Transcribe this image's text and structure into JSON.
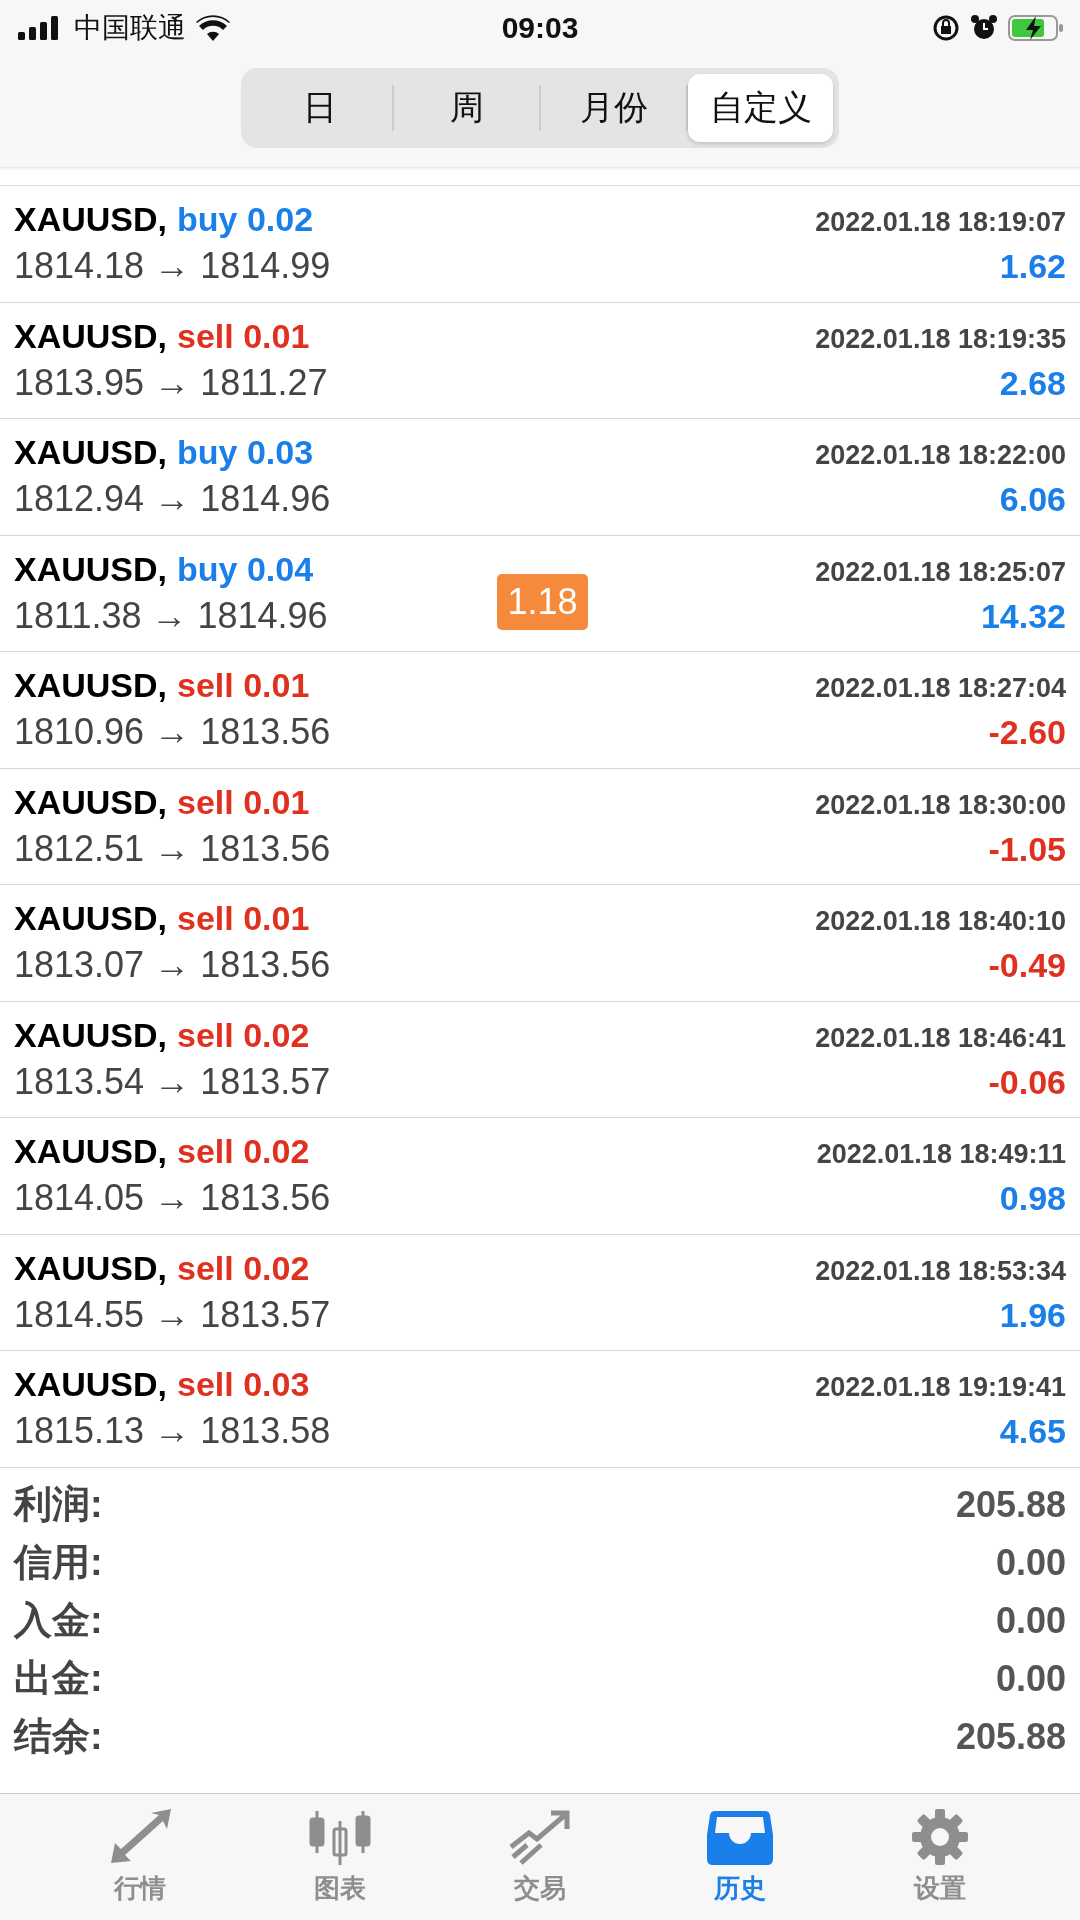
{
  "status_bar": {
    "carrier": "中国联通",
    "time": "09:03"
  },
  "tabs": [
    {
      "label": "日",
      "selected": false
    },
    {
      "label": "周",
      "selected": false
    },
    {
      "label": "月份",
      "selected": false
    },
    {
      "label": "自定义",
      "selected": true
    }
  ],
  "deals": [
    {
      "symbol": "XAUUSD,",
      "kind": "buy",
      "volume": "buy 0.02",
      "time": "2022.01.18 18:19:07",
      "prices": "1814.18 → 1814.99",
      "profit": "1.62",
      "negative": false
    },
    {
      "symbol": "XAUUSD,",
      "kind": "sell",
      "volume": "sell 0.01",
      "time": "2022.01.18 18:19:35",
      "prices": "1813.95 → 1811.27",
      "profit": "2.68",
      "negative": false
    },
    {
      "symbol": "XAUUSD,",
      "kind": "buy",
      "volume": "buy 0.03",
      "time": "2022.01.18 18:22:00",
      "prices": "1812.94 → 1814.96",
      "profit": "6.06",
      "negative": false
    },
    {
      "symbol": "XAUUSD,",
      "kind": "buy",
      "volume": "buy 0.04",
      "time": "2022.01.18 18:25:07",
      "prices": "1811.38 → 1814.96",
      "profit": "14.32",
      "negative": false
    },
    {
      "symbol": "XAUUSD,",
      "kind": "sell",
      "volume": "sell 0.01",
      "time": "2022.01.18 18:27:04",
      "prices": "1810.96 → 1813.56",
      "profit": "-2.60",
      "negative": true
    },
    {
      "symbol": "XAUUSD,",
      "kind": "sell",
      "volume": "sell 0.01",
      "time": "2022.01.18 18:30:00",
      "prices": "1812.51 → 1813.56",
      "profit": "-1.05",
      "negative": true
    },
    {
      "symbol": "XAUUSD,",
      "kind": "sell",
      "volume": "sell 0.01",
      "time": "2022.01.18 18:40:10",
      "prices": "1813.07 → 1813.56",
      "profit": "-0.49",
      "negative": true
    },
    {
      "symbol": "XAUUSD,",
      "kind": "sell",
      "volume": "sell 0.02",
      "time": "2022.01.18 18:46:41",
      "prices": "1813.54 → 1813.57",
      "profit": "-0.06",
      "negative": true
    },
    {
      "symbol": "XAUUSD,",
      "kind": "sell",
      "volume": "sell 0.02",
      "time": "2022.01.18 18:49:11",
      "prices": "1814.05 → 1813.56",
      "profit": "0.98",
      "negative": false
    },
    {
      "symbol": "XAUUSD,",
      "kind": "sell",
      "volume": "sell 0.02",
      "time": "2022.01.18 18:53:34",
      "prices": "1814.55 → 1813.57",
      "profit": "1.96",
      "negative": false
    },
    {
      "symbol": "XAUUSD,",
      "kind": "sell",
      "volume": "sell 0.03",
      "time": "2022.01.18 19:19:41",
      "prices": "1815.13 → 1813.58",
      "profit": "4.65",
      "negative": false
    }
  ],
  "badge": "1.18",
  "summary": [
    {
      "label": "利润:",
      "value": "205.88"
    },
    {
      "label": "信用:",
      "value": "0.00"
    },
    {
      "label": "入金:",
      "value": "0.00"
    },
    {
      "label": "出金:",
      "value": "0.00"
    },
    {
      "label": "结余:",
      "value": "205.88"
    }
  ],
  "nav": [
    {
      "label": "行情",
      "kind": "quotes",
      "selected": false
    },
    {
      "label": "图表",
      "kind": "chart",
      "selected": false
    },
    {
      "label": "交易",
      "kind": "trade",
      "selected": false
    },
    {
      "label": "历史",
      "kind": "history",
      "selected": true
    },
    {
      "label": "设置",
      "kind": "settings",
      "selected": false
    }
  ]
}
